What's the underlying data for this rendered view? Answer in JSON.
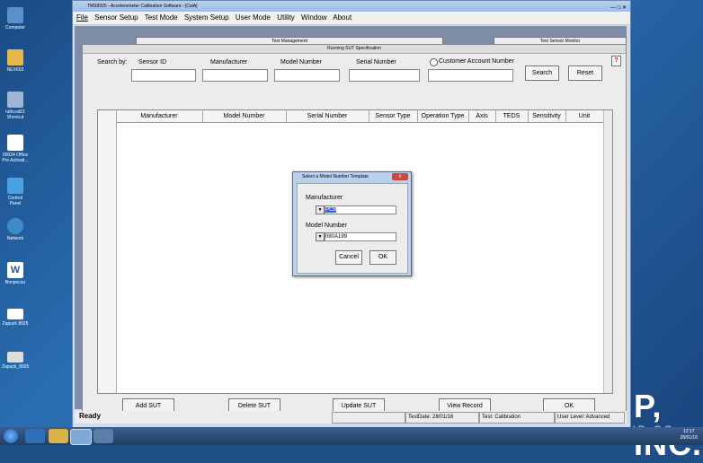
{
  "desktop": {
    "icons": [
      {
        "label": "Computer",
        "icon": "computer-icon"
      },
      {
        "label": "NEX603",
        "icon": "shortcut-icon"
      },
      {
        "label": "ndhcod01 Shortcut",
        "icon": "shortcut-icon"
      },
      {
        "label": "00024 Office Pro Activati...",
        "icon": "document-icon"
      },
      {
        "label": "Control Panel",
        "icon": "control-panel-icon"
      },
      {
        "label": "Network",
        "icon": "network-icon"
      },
      {
        "label": "Bonpocsu",
        "icon": "word-icon"
      },
      {
        "label": "Zapuck 8925",
        "icon": "folder-icon"
      },
      {
        "label": "Zapuck_8925",
        "icon": "app-icon"
      }
    ],
    "watermark_main": "P, INC.",
    "watermark_sub": "A PCB GROUP CO"
  },
  "taskbar": {
    "time": "12:17",
    "date": "28/01/16"
  },
  "window": {
    "title": "TMS9925 - Accelerometer Calibration Software - [CalA]",
    "menu": [
      "File",
      "Sensor Setup",
      "Test Mode",
      "System Setup",
      "User Mode",
      "Utility",
      "Window",
      "About"
    ],
    "tabs": [
      "Test Management",
      "Test Sensor Monitor"
    ],
    "sut": {
      "title": "Running SUT Specification",
      "search_by_label": "Search by:",
      "fields": [
        {
          "label": "Sensor ID",
          "value": ""
        },
        {
          "label": "Manufacturer",
          "value": ""
        },
        {
          "label": "Model Number",
          "value": ""
        },
        {
          "label": "Serial Number",
          "value": ""
        }
      ],
      "customer_account_label": "Customer Account Number",
      "search_button": "Search",
      "reset_button": "Reset",
      "help_button": "?",
      "columns": [
        "Manufacturer",
        "Model Number",
        "Serial Number",
        "Sensor Type",
        "Operation Type",
        "Axis",
        "TEDS",
        "Sensitivity",
        "Unit"
      ],
      "buttons": [
        "Add SUT",
        "Delete SUT",
        "Update SUT",
        "View Record",
        "OK"
      ]
    },
    "status": {
      "ready": "Ready",
      "test_date": "TestDate:  28/01/16",
      "test_mode": "Test: Calibration",
      "user_level": "User Level: Advanced"
    }
  },
  "dialog": {
    "title": "Select a Model Number Template",
    "manufacturer_label": "Manufacturer",
    "manufacturer_value": "PCB",
    "model_label": "Model Number",
    "model_value": "080A199",
    "cancel": "Cancel",
    "ok": "OK",
    "close": "x"
  }
}
